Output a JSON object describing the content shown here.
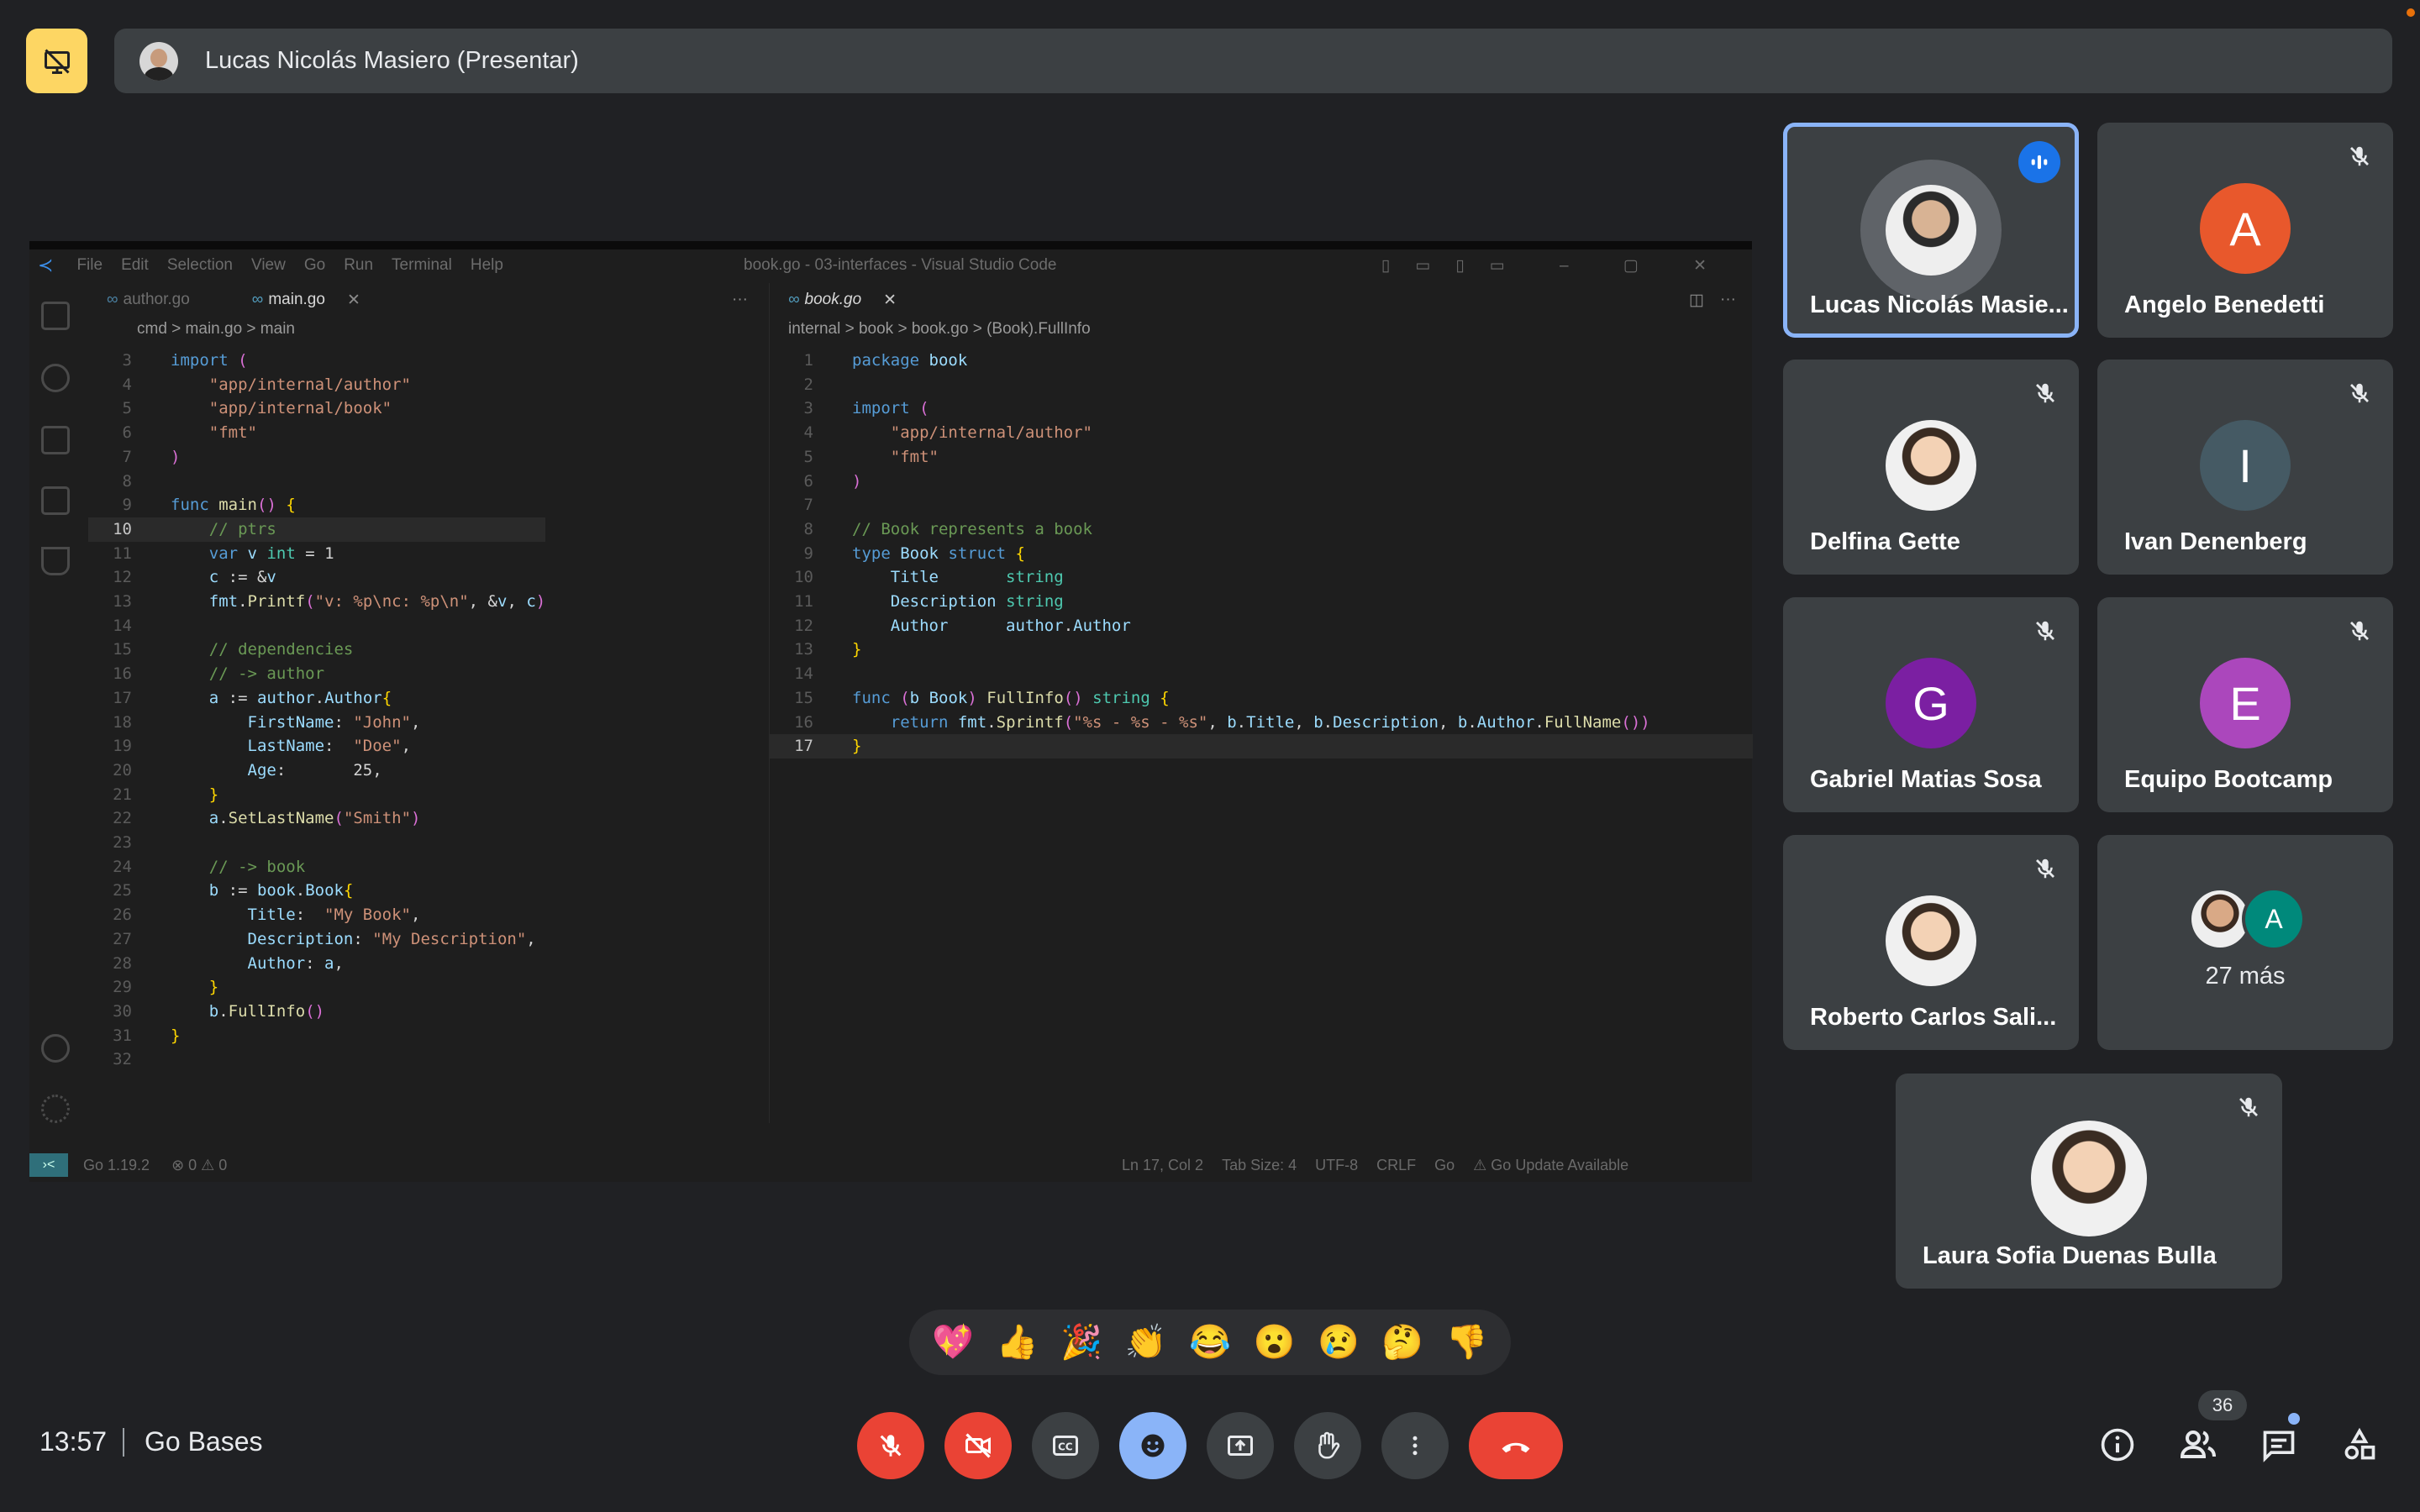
{
  "presenter": {
    "name": "Lucas Nicolás Masiero (Presentar)"
  },
  "vscode": {
    "menu": [
      "File",
      "Edit",
      "Selection",
      "View",
      "Go",
      "Run",
      "Terminal",
      "Help"
    ],
    "window_title": "book.go - 03-interfaces - Visual Studio Code",
    "left_tabs": [
      "author.go",
      "main.go"
    ],
    "right_tabs": [
      "book.go"
    ],
    "left_breadcrumb": "cmd > main.go > main",
    "right_breadcrumb": "internal > book > book.go > (Book).FullInfo",
    "left_code": [
      {
        "n": "3",
        "t": "import ("
      },
      {
        "n": "4",
        "t": "    \"app/internal/author\""
      },
      {
        "n": "5",
        "t": "    \"app/internal/book\""
      },
      {
        "n": "6",
        "t": "    \"fmt\""
      },
      {
        "n": "7",
        "t": ")"
      },
      {
        "n": "8",
        "t": ""
      },
      {
        "n": "9",
        "t": "func main() {"
      },
      {
        "n": "10",
        "t": "    // ptrs"
      },
      {
        "n": "11",
        "t": "    var v int = 1"
      },
      {
        "n": "12",
        "t": "    c := &v"
      },
      {
        "n": "13",
        "t": "    fmt.Printf(\"v: %p\\nc: %p\\n\", &v, c)"
      },
      {
        "n": "14",
        "t": ""
      },
      {
        "n": "15",
        "t": "    // dependencies"
      },
      {
        "n": "16",
        "t": "    // -> author"
      },
      {
        "n": "17",
        "t": "    a := author.Author{"
      },
      {
        "n": "18",
        "t": "        FirstName: \"John\","
      },
      {
        "n": "19",
        "t": "        LastName:  \"Doe\","
      },
      {
        "n": "20",
        "t": "        Age:       25,"
      },
      {
        "n": "21",
        "t": "    }"
      },
      {
        "n": "22",
        "t": "    a.SetLastName(\"Smith\")"
      },
      {
        "n": "23",
        "t": ""
      },
      {
        "n": "24",
        "t": "    // -> book"
      },
      {
        "n": "25",
        "t": "    b := book.Book{"
      },
      {
        "n": "26",
        "t": "        Title:  \"My Book\","
      },
      {
        "n": "27",
        "t": "        Description: \"My Description\","
      },
      {
        "n": "28",
        "t": "        Author: a,"
      },
      {
        "n": "29",
        "t": "    }"
      },
      {
        "n": "30",
        "t": "    b.FullInfo()"
      },
      {
        "n": "31",
        "t": "}"
      },
      {
        "n": "32",
        "t": ""
      }
    ],
    "right_code": [
      {
        "n": "1",
        "t": "package book"
      },
      {
        "n": "2",
        "t": ""
      },
      {
        "n": "3",
        "t": "import ("
      },
      {
        "n": "4",
        "t": "    \"app/internal/author\""
      },
      {
        "n": "5",
        "t": "    \"fmt\""
      },
      {
        "n": "6",
        "t": ")"
      },
      {
        "n": "7",
        "t": ""
      },
      {
        "n": "8",
        "t": "// Book represents a book"
      },
      {
        "n": "9",
        "t": "type Book struct {"
      },
      {
        "n": "10",
        "t": "    Title       string"
      },
      {
        "n": "11",
        "t": "    Description string"
      },
      {
        "n": "12",
        "t": "    Author      author.Author"
      },
      {
        "n": "13",
        "t": "}"
      },
      {
        "n": "14",
        "t": ""
      },
      {
        "n": "15",
        "t": "func (b Book) FullInfo() string {"
      },
      {
        "n": "16",
        "t": "    return fmt.Sprintf(\"%s - %s - %s\", b.Title, b.Description, b.Author.FullName())"
      },
      {
        "n": "17",
        "t": "}"
      }
    ],
    "status_left": [
      "Go 1.19.2",
      "⊗ 0 ⚠ 0"
    ],
    "status_right": [
      "Ln 17, Col 2",
      "Tab Size: 4",
      "UTF-8",
      "CRLF",
      "Go",
      "⚠ Go Update Available"
    ]
  },
  "participants": [
    {
      "name": "Lucas Nicolás Masie...",
      "initial": "",
      "color": "#5f6368",
      "photo": true,
      "speaking": true
    },
    {
      "name": "Angelo Benedetti",
      "initial": "A",
      "color": "#e8582c",
      "photo": false,
      "speaking": false
    },
    {
      "name": "Delfina Gette",
      "initial": "",
      "color": "#d9c7b4",
      "photo": true,
      "speaking": false
    },
    {
      "name": "Ivan Denenberg",
      "initial": "I",
      "color": "#455a64",
      "photo": false,
      "speaking": false
    },
    {
      "name": "Gabriel Matias Sosa",
      "initial": "G",
      "color": "#7b1fa2",
      "photo": false,
      "speaking": false
    },
    {
      "name": "Equipo Bootcamp",
      "initial": "E",
      "color": "#ab47bc",
      "photo": false,
      "speaking": false
    },
    {
      "name": "Roberto Carlos Sali...",
      "initial": "",
      "color": "#cfd8dc",
      "photo": true,
      "speaking": false
    },
    {
      "name": "Laura Sofia Duenas Bulla",
      "initial": "",
      "color": "#efe6dc",
      "photo": true,
      "speaking": false
    }
  ],
  "more": {
    "label": "27 más",
    "avatar_initial": "A",
    "avatar_color": "#00897b"
  },
  "reactions": [
    "💖",
    "👍",
    "🎉",
    "👏",
    "😂",
    "😮",
    "😢",
    "🤔",
    "👎"
  ],
  "bottom": {
    "time": "13:57",
    "meeting": "Go Bases",
    "people_count": "36"
  },
  "colors": {
    "bg": "#202124",
    "tile": "#3c4043",
    "accent": "#8ab4f8",
    "danger": "#ea4335",
    "present": "#fdd663"
  }
}
